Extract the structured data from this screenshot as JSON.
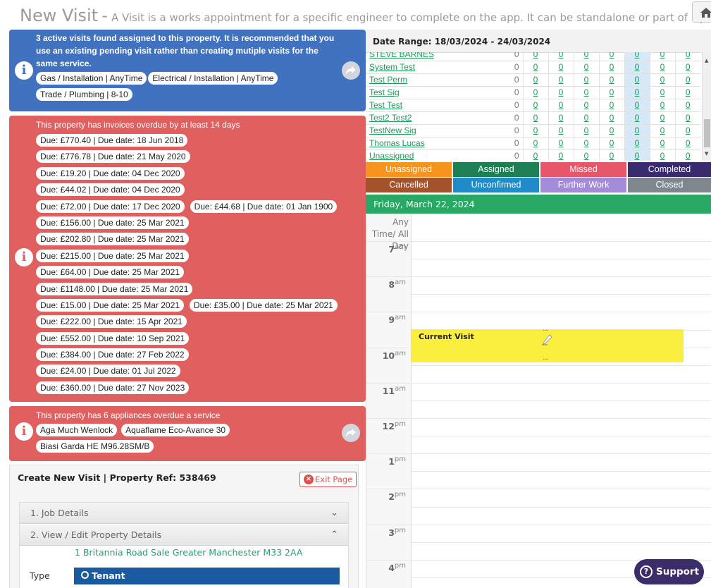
{
  "header": {
    "title": "New Visit",
    "separator": "-",
    "description": "A Visit is a works appointment for a specific engineer to complete on the app. It can be standalone or part of a Job."
  },
  "alerts": {
    "visits": {
      "message_pre": "3 active visits found assigned to this property. It is ",
      "message_strong": "recommended",
      "message_post": " that you use an existing pending visit rather than creating mutiple visits for the same service.",
      "tags": [
        "Gas / Installation | AnyTime",
        "Electrical / Installation | AnyTime",
        "Trade / Plumbing | 8-10"
      ]
    },
    "invoices": {
      "message": "This property has invoices overdue by at least 14 days",
      "rows": [
        [
          "Due: £770.40 | Due date: 18 Jun 2018"
        ],
        [
          "Due: £776.78 | Due date: 21 May 2020"
        ],
        [
          "Due: £19.20 | Due date: 04 Dec 2020"
        ],
        [
          "Due: £44.02 | Due date: 04 Dec 2020"
        ],
        [
          "Due: £72.00 | Due date: 17 Dec 2020",
          "Due: £44.68 | Due date: 01 Jan 1900"
        ],
        [
          "Due: £156.00 | Due date: 25 Mar 2021"
        ],
        [
          "Due: £202.80 | Due date: 25 Mar 2021"
        ],
        [
          "Due: £215.00 | Due date: 25 Mar 2021"
        ],
        [
          "Due: £64.00 | Due date: 25 Mar 2021"
        ],
        [
          "Due: £1148.00 | Due date: 25 Mar 2021"
        ],
        [
          "Due: £15.00 | Due date: 25 Mar 2021",
          "Due: £35.00 | Due date: 25 Mar 2021"
        ],
        [
          "Due: £222.00 | Due date: 15 Apr 2021"
        ],
        [
          "Due: £552.00 | Due date: 10 Sep 2021"
        ],
        [
          "Due: £384.00 | Due date: 27 Feb 2022"
        ],
        [
          "Due: £24.00 | Due date: 01 Jul 2022"
        ],
        [
          "Due: £360.00 | Due date: 27 Nov 2023"
        ]
      ]
    },
    "appliances": {
      "message": "This property has 6 appliances overdue a service",
      "tags": [
        "Aga Much Wenlock",
        "Aquaflame Eco-Avance 30",
        "Biasi Garda HE M96.28SM/B"
      ]
    }
  },
  "create_visit": {
    "title": "Create New Visit | Property Ref: 538469",
    "exit_label": "Exit Page",
    "sections": [
      "1. Job Details",
      "2. View / Edit Property Details"
    ],
    "address": "1 Britannia Road Sale Greater Manchester M33 2AA",
    "type_label": "Type",
    "type_value": "Tenant"
  },
  "date_range": "Date Range: 18/03/2024 - 24/03/2024",
  "engineers": [
    {
      "name": "STEVE BARNES",
      "total": "0",
      "days": [
        "0",
        "0",
        "0",
        "0",
        "0",
        "0",
        "0"
      ]
    },
    {
      "name": "System Test",
      "total": "0",
      "days": [
        "0",
        "0",
        "0",
        "0",
        "0",
        "0",
        "0"
      ]
    },
    {
      "name": "Test Perm",
      "total": "0",
      "days": [
        "0",
        "0",
        "0",
        "0",
        "0",
        "0",
        "0"
      ]
    },
    {
      "name": "Test Sig",
      "total": "0",
      "days": [
        "0",
        "0",
        "0",
        "0",
        "0",
        "0",
        "0"
      ]
    },
    {
      "name": "Test Test",
      "total": "0",
      "days": [
        "0",
        "0",
        "0",
        "0",
        "0",
        "0",
        "0"
      ]
    },
    {
      "name": "Test2 Test2",
      "total": "0",
      "days": [
        "0",
        "0",
        "0",
        "0",
        "0",
        "0",
        "0"
      ]
    },
    {
      "name": "TestNew Sig",
      "total": "0",
      "days": [
        "0",
        "0",
        "0",
        "0",
        "0",
        "0",
        "0"
      ]
    },
    {
      "name": "Thomas Lucas",
      "total": "0",
      "days": [
        "0",
        "0",
        "0",
        "0",
        "0",
        "0",
        "0"
      ]
    },
    {
      "name": "Unassigned",
      "total": "0",
      "days": [
        "0",
        "0",
        "0",
        "0",
        "0",
        "0",
        "0"
      ]
    }
  ],
  "legend": [
    {
      "label": "Unassigned",
      "color": "#f7941d"
    },
    {
      "label": "Assigned",
      "color": "#1e7f55"
    },
    {
      "label": "Missed",
      "color": "#e8566a"
    },
    {
      "label": "Completed",
      "color": "#3a2a6e"
    },
    {
      "label": "Cancelled",
      "color": "#a3522b"
    },
    {
      "label": "Unconfirmed",
      "color": "#1f8bc9"
    },
    {
      "label": "Further Work",
      "color": "#a28cd8"
    },
    {
      "label": "Closed",
      "color": "#7e878e"
    }
  ],
  "calendar": {
    "day_title": "Friday, March 22, 2024",
    "all_day_label": "Any Time/ All Day",
    "hours": [
      {
        "h": "7",
        "ap": "am"
      },
      {
        "h": "8",
        "ap": "am"
      },
      {
        "h": "9",
        "ap": "am"
      },
      {
        "h": "10",
        "ap": "am"
      },
      {
        "h": "11",
        "ap": "am"
      },
      {
        "h": "12",
        "ap": "pm"
      },
      {
        "h": "1",
        "ap": "pm"
      },
      {
        "h": "2",
        "ap": "pm"
      },
      {
        "h": "3",
        "ap": "pm"
      },
      {
        "h": "4",
        "ap": "pm"
      }
    ],
    "event_title": "Current Visit",
    "event_color": "#faee3e"
  },
  "support_label": "Support"
}
